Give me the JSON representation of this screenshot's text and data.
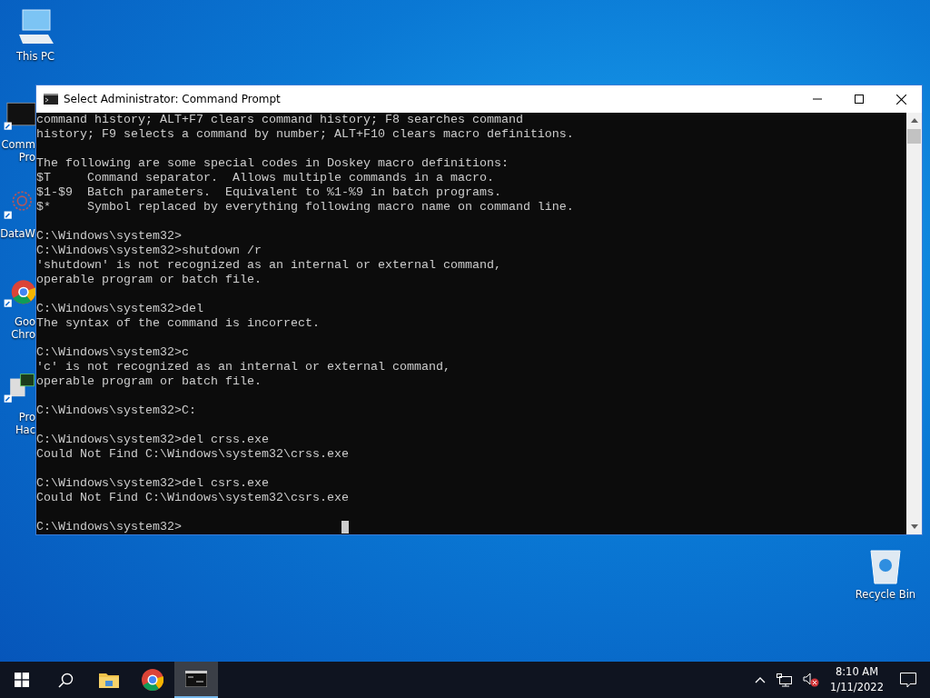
{
  "desktop_icons": [
    {
      "kind": "pc",
      "lines": [
        "This PC"
      ]
    },
    {
      "kind": "cmd",
      "lines": [
        "Comm",
        "Pro"
      ]
    },
    {
      "kind": "data",
      "lines": [
        "DataW"
      ]
    },
    {
      "kind": "chrome",
      "lines": [
        "Goo",
        "Chro"
      ]
    },
    {
      "kind": "hacker",
      "lines": [
        "Pro",
        "Hac"
      ]
    },
    {
      "kind": "bin",
      "lines": [
        "Recycle Bin"
      ]
    }
  ],
  "window": {
    "title": "Select Administrator: Command Prompt",
    "console": [
      [
        "command history; ALT+F7 clears command history; F8 searches command",
        "history; F9 selects a command by number; ALT+F10 clears macro definitions."
      ],
      [
        "The following are some special codes in Doskey macro definitions:",
        "$T     Command separator.  Allows multiple commands in a macro.",
        "$1-$9  Batch parameters.  Equivalent to %1-%9 in batch programs.",
        "$*     Symbol replaced by everything following macro name on command line."
      ],
      [
        "C:\\Windows\\system32>",
        "C:\\Windows\\system32>shutdown /r",
        "'shutdown' is not recognized as an internal or external command,",
        "operable program or batch file."
      ],
      [
        "C:\\Windows\\system32>del",
        "The syntax of the command is incorrect."
      ],
      [
        "C:\\Windows\\system32>c",
        "'c' is not recognized as an internal or external command,",
        "operable program or batch file."
      ],
      [
        "C:\\Windows\\system32>C:"
      ],
      [
        "C:\\Windows\\system32>del crss.exe",
        "Could Not Find C:\\Windows\\system32\\crss.exe"
      ],
      [
        "C:\\Windows\\system32>del csrs.exe",
        "Could Not Find C:\\Windows\\system32\\csrs.exe"
      ]
    ],
    "prompt": "C:\\Windows\\system32>"
  },
  "taskbar": {
    "apps": [
      {
        "kind": "start",
        "selected": false
      },
      {
        "kind": "search",
        "selected": false
      },
      {
        "kind": "explorer",
        "selected": false
      },
      {
        "kind": "chrome",
        "selected": false
      },
      {
        "kind": "cmd",
        "selected": true
      }
    ],
    "time": "8:10 AM",
    "date": "1/11/2022"
  }
}
